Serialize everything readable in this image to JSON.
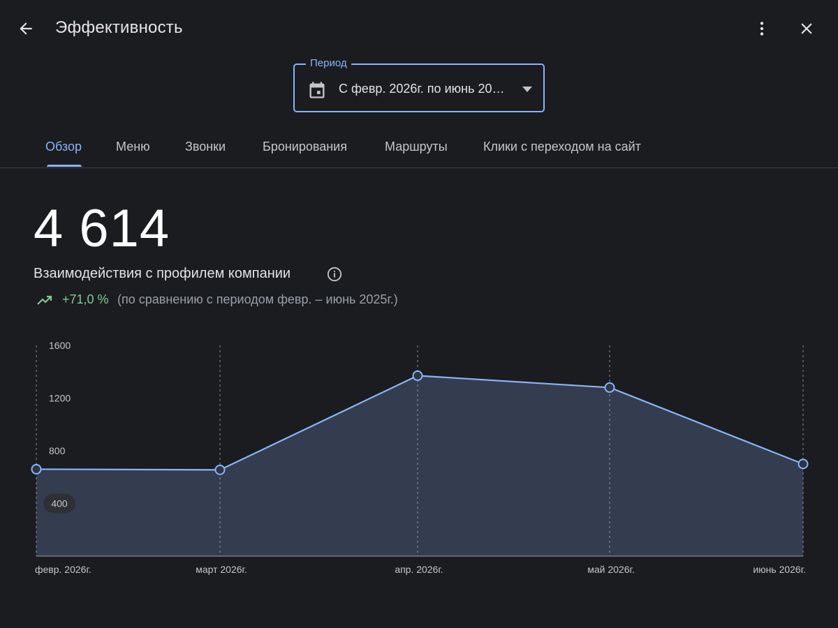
{
  "header": {
    "title": "Эффективность",
    "icons": {
      "back": "arrow-back-icon",
      "more": "more-vert-icon",
      "close": "close-icon"
    }
  },
  "period": {
    "label": "Период",
    "value": "С февр. 2026г. по июнь 20…",
    "icon": "calendar-icon"
  },
  "tabs": [
    {
      "label": "Обзор",
      "active": true
    },
    {
      "label": "Меню",
      "active": false
    },
    {
      "label": "Звонки",
      "active": false
    },
    {
      "label": "Бронирования",
      "active": false
    },
    {
      "label": "Маршруты",
      "active": false
    },
    {
      "label": "Клики с переходом на сайт",
      "active": false
    }
  ],
  "summary": {
    "total": "4 614",
    "label": "Взаимодействия с профилем компании",
    "change": "+71,0 %",
    "comparison": "(по сравнению с периодом февр. – июнь 2025г.)"
  },
  "colors": {
    "accent": "#8ab4f8",
    "positive": "#81c995",
    "background": "#1b1c20"
  },
  "chart_data": {
    "type": "area",
    "x": [
      "февр. 2026г.",
      "март 2026г.",
      "апр. 2026г.",
      "май 2026г.",
      "июнь 2026г."
    ],
    "values": [
      660,
      655,
      1370,
      1280,
      700
    ],
    "yticks": [
      "1600",
      "1200",
      "800",
      "400"
    ],
    "ylim": [
      0,
      1600
    ],
    "title": "",
    "xlabel": "",
    "ylabel": "",
    "grid": "vertical-dashed",
    "highlighted_ytick": "400"
  }
}
